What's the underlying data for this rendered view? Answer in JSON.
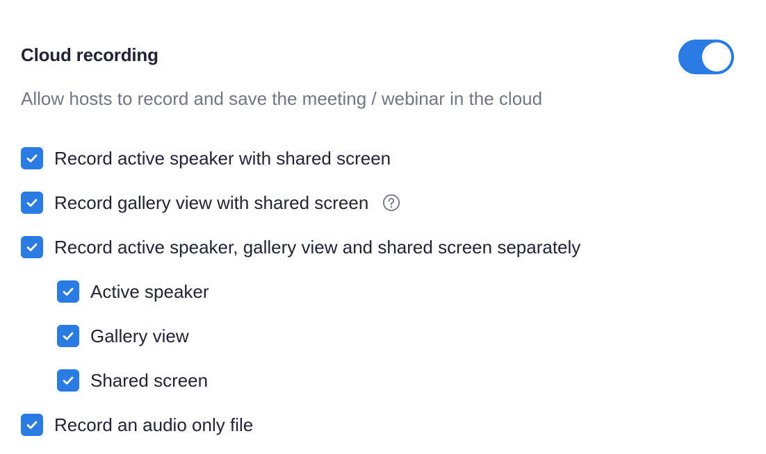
{
  "setting": {
    "title": "Cloud recording",
    "description": "Allow hosts to record and save the meeting / webinar in the cloud",
    "enabled": true,
    "accent_color": "#2b7be4"
  },
  "options": [
    {
      "label": "Record active speaker with shared screen",
      "checked": true
    },
    {
      "label": "Record gallery view with shared screen",
      "checked": true,
      "help_icon": "question-circle-icon"
    },
    {
      "label": "Record active speaker, gallery view and shared screen separately",
      "checked": true
    },
    {
      "label": "Active speaker",
      "checked": true
    },
    {
      "label": "Gallery view",
      "checked": true
    },
    {
      "label": "Shared screen",
      "checked": true
    },
    {
      "label": "Record an audio only file",
      "checked": true
    }
  ]
}
